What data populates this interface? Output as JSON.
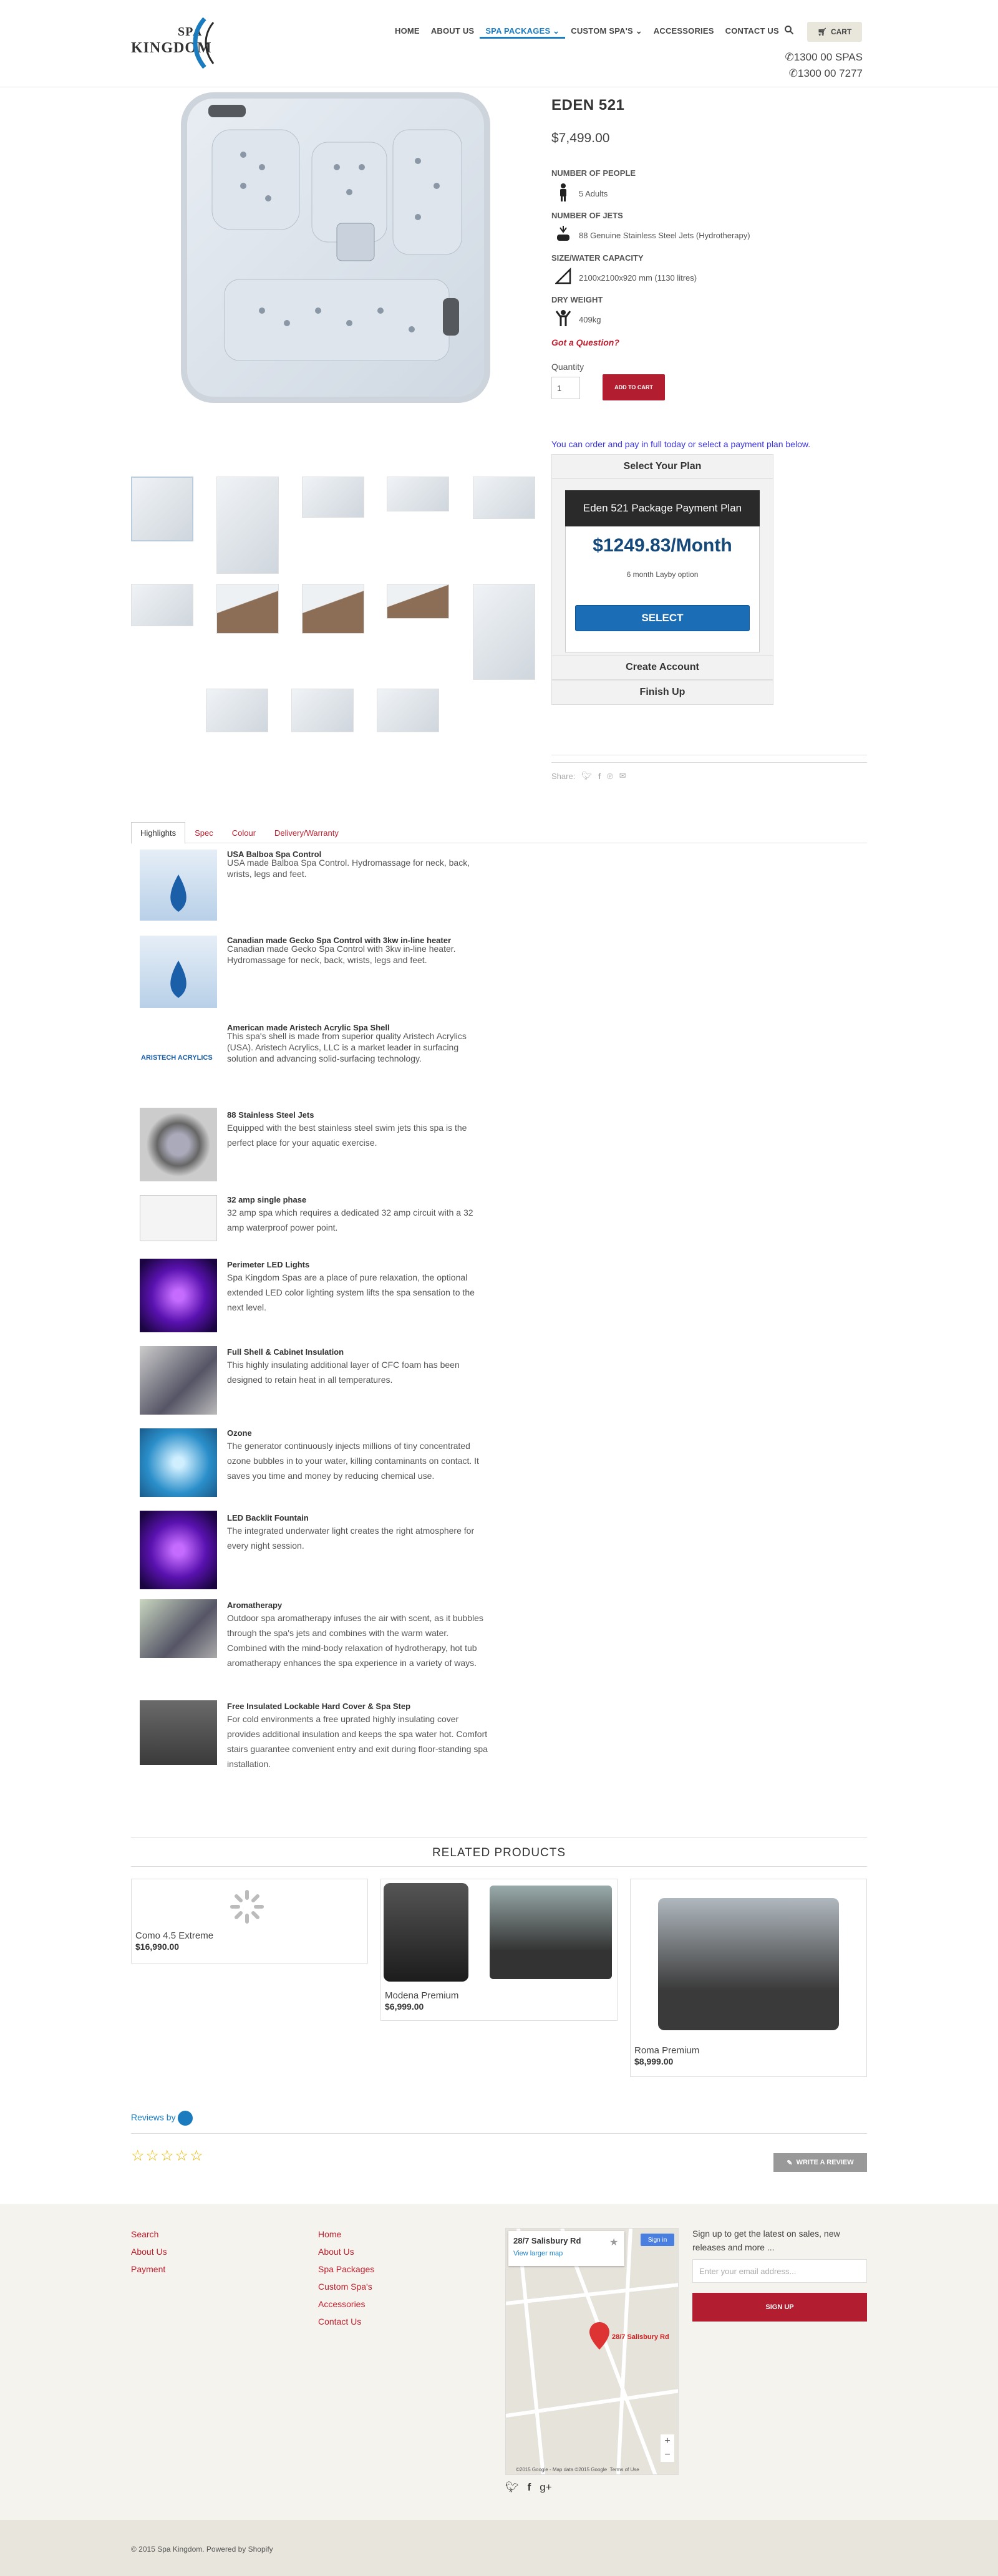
{
  "brand": {
    "line1": "SPA",
    "line2": "KINGDOM"
  },
  "nav": {
    "items": [
      "HOME",
      "ABOUT US",
      "SPA PACKAGES",
      "CUSTOM SPA'S",
      "ACCESSORIES",
      "CONTACT US"
    ],
    "cart_label": "CART",
    "phones": [
      "1300 00 SPAS",
      "1300 00 7277"
    ]
  },
  "product": {
    "title": "EDEN 521",
    "price": "$7,499.00",
    "specs": [
      {
        "heading": "NUMBER OF PEOPLE",
        "value": "5 Adults",
        "icon": "person-icon"
      },
      {
        "heading": "NUMBER OF JETS",
        "value": "88 Genuine Stainless Steel Jets (Hydrotherapy)",
        "icon": "jet-icon"
      },
      {
        "heading": "SIZE/WATER CAPACITY",
        "value": "2100x2100x920 mm (1130 litres)",
        "icon": "size-icon"
      },
      {
        "heading": "DRY WEIGHT",
        "value": "409kg",
        "icon": "weight-icon"
      }
    ],
    "question": "Got a Question?",
    "quantity_label": "Quantity",
    "quantity_value": "1",
    "add_to_cart": "ADD TO CART"
  },
  "plan": {
    "note": "You can order and pay in full today or select a payment plan below.",
    "select_header": "Select Your Plan",
    "card_title": "Eden 521 Package Payment Plan",
    "card_price": "$1249.83/Month",
    "card_sub": "6 month Layby option",
    "select_btn": "SELECT",
    "create_account": "Create Account",
    "finish_up": "Finish Up"
  },
  "share": {
    "label": "Share:"
  },
  "tabs": [
    "Highlights",
    "Spec",
    "Colour",
    "Delivery/Warranty"
  ],
  "features": [
    {
      "title": "USA Balboa Spa Control",
      "desc": "USA made Balboa Spa Control. Hydromassage for neck, back, wrists, legs and feet."
    },
    {
      "title": "Canadian made Gecko Spa Control with 3kw in-line heater",
      "desc": "Canadian made Gecko Spa Control with 3kw in-line heater. Hydromassage for neck, back, wrists, legs and feet."
    },
    {
      "title": "American made Aristech Acrylic Spa Shell",
      "desc": "This spa's shell is made from superior quality Aristech Acrylics (USA). Aristech Acrylics, LLC is a market leader in surfacing solution and advancing solid-surfacing technology."
    },
    {
      "title": "88 Stainless Steel Jets",
      "desc": "Equipped with the best stainless steel swim jets this spa is the perfect place for your aquatic exercise."
    },
    {
      "title": "32 amp single phase",
      "desc": "32 amp spa which requires a dedicated 32 amp circuit with a 32 amp waterproof power point."
    },
    {
      "title": "Perimeter LED Lights",
      "desc": "Spa Kingdom Spas are a place of pure relaxation, the optional extended LED color lighting system lifts the spa sensation to the next level."
    },
    {
      "title": "Full Shell & Cabinet Insulation",
      "desc": "This highly insulating additional layer of CFC foam has been designed to retain heat in all temperatures."
    },
    {
      "title": "Ozone",
      "desc": "The generator continuously injects millions of tiny concentrated ozone bubbles in to your water, killing contaminants on contact. It saves you time and money by reducing chemical use."
    },
    {
      "title": "LED Backlit Fountain",
      "desc": "The integrated underwater light creates the right atmosphere for every night session."
    },
    {
      "title": "Aromatherapy",
      "desc": "Outdoor spa aromatherapy infuses the air with scent, as it bubbles through the spa's jets and combines with the warm water. Combined with the mind-body relaxation of hydrotherapy, hot tub aromatherapy enhances the spa experience in a variety of ways."
    },
    {
      "title": "Free Insulated Lockable Hard Cover & Spa Step",
      "desc": "For cold environments a free uprated highly insulating cover provides additional insulation and keeps the spa water hot. Comfort stairs guarantee convenient entry and exit during floor-standing spa installation."
    }
  ],
  "aristech_logo": "ARISTECH ACRYLICS",
  "related": {
    "title": "RELATED PRODUCTS",
    "items": [
      {
        "name": "Como 4.5 Extreme",
        "price": "$16,990.00"
      },
      {
        "name": "Modena Premium",
        "price": "$6,999.00"
      },
      {
        "name": "Roma Premium",
        "price": "$8,999.00"
      }
    ]
  },
  "reviews": {
    "by": "Reviews by",
    "write": "WRITE A REVIEW"
  },
  "footer": {
    "col1_links": [
      "Search",
      "About Us",
      "Payment"
    ],
    "col2_links": [
      "Home",
      "About Us",
      "Spa Packages",
      "Custom Spa's",
      "Accessories",
      "Contact Us"
    ],
    "map": {
      "address": "28/7 Salisbury Rd",
      "larger": "View larger map",
      "signin": "Sign in",
      "pin": "28/7 Salisbury Rd",
      "credit": "©2015 Google - Map data ©2015 Google",
      "terms": "Terms of Use"
    },
    "newsletter": "Sign up to get the latest on sales, new releases and more ...",
    "email_placeholder": "Enter your email address...",
    "signup": "SIGN UP",
    "copyright": "© 2015 Spa Kingdom. Powered by Shopify"
  },
  "colors": {
    "accent": "#b21e2f",
    "link": "#1a7bbf",
    "plan_blue": "#1b6db5"
  }
}
